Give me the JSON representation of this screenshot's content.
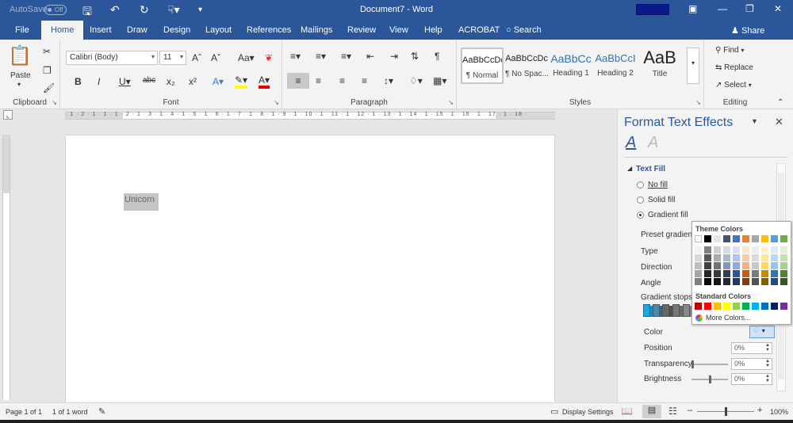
{
  "app": {
    "autosave_label": "AutoSave",
    "autosave_state": "Off",
    "document_title": "Document7  -  Word"
  },
  "tabs": [
    "File",
    "Home",
    "Insert",
    "Draw",
    "Design",
    "Layout",
    "References",
    "Mailings",
    "Review",
    "View",
    "Help",
    "ACROBAT"
  ],
  "active_tab": "Home",
  "search_label": "Search",
  "share_label": "Share",
  "ribbon": {
    "clipboard": {
      "paste": "Paste",
      "label": "Clipboard"
    },
    "font": {
      "name": "Calibri (Body)",
      "size": "11",
      "label": "Font"
    },
    "paragraph": {
      "label": "Paragraph"
    },
    "styles": {
      "label": "Styles",
      "items": [
        {
          "sample": "AaBbCcDc",
          "name": "¶ Normal"
        },
        {
          "sample": "AaBbCcDc",
          "name": "¶ No Spac..."
        },
        {
          "sample": "AaBbCc",
          "name": "Heading 1"
        },
        {
          "sample": "AaBbCcI",
          "name": "Heading 2"
        },
        {
          "sample": "AaB",
          "name": "Title"
        }
      ]
    },
    "editing": {
      "find": "Find",
      "replace": "Replace",
      "select": "Select",
      "label": "Editing"
    }
  },
  "ruler_numbers": "· 1 · 2 · 1 · 1 · 1 · 2 · 1 · 3 · 1 · 4 · 1 · 5 · 1 · 6 · 1 · 7 · 1 · 8 · 1 · 9 · 1 · 10 · 1 · 11 · 1 · 12 · 1 · 13 · 1 · 14 · 1 · 15 · 1 · 16 · 1 · 17 · 1 · 18 ·",
  "document": {
    "selected_text": "Unicorn"
  },
  "pane": {
    "title": "Format Text Effects",
    "section": "Text Fill",
    "fill_options": [
      "No fill",
      "Solid fill",
      "Gradient fill"
    ],
    "selected_fill": "Gradient fill",
    "labels": {
      "preset": "Preset gradients",
      "type": "Type",
      "direction": "Direction",
      "angle": "Angle",
      "stops": "Gradient stops",
      "color": "Color",
      "position": "Position",
      "transparency": "Transparency",
      "brightness": "Brightness"
    },
    "values": {
      "position": "0%",
      "transparency": "0%",
      "brightness": "0%"
    }
  },
  "color_picker": {
    "theme_label": "Theme Colors",
    "standard_label": "Standard Colors",
    "more_label": "More Colors...",
    "theme_top": [
      "#ffffff",
      "#000000",
      "#e7e6e6",
      "#44546a",
      "#4472c4",
      "#ed7d31",
      "#a5a5a5",
      "#ffc000",
      "#5b9bd5",
      "#70ad47"
    ],
    "theme_shades": [
      [
        "#f2f2f2",
        "#808080",
        "#d0cece",
        "#d6dce4",
        "#d9e2f3",
        "#fbe5d5",
        "#ededed",
        "#fff2cc",
        "#deebf6",
        "#e2efd9"
      ],
      [
        "#d8d8d8",
        "#595959",
        "#aeaaaa",
        "#adb9ca",
        "#b4c6e7",
        "#f7caac",
        "#dbdbdb",
        "#fee599",
        "#bdd7ee",
        "#c5e0b3"
      ],
      [
        "#bfbfbf",
        "#404040",
        "#757070",
        "#8496b0",
        "#8eaadb",
        "#f4b183",
        "#c9c9c9",
        "#ffd965",
        "#9cc3e5",
        "#a8d08d"
      ],
      [
        "#a5a5a5",
        "#262626",
        "#3a3838",
        "#323f4f",
        "#2f5496",
        "#c55a11",
        "#7b7b7b",
        "#bf9000",
        "#2e75b5",
        "#538135"
      ],
      [
        "#7f7f7f",
        "#0d0d0d",
        "#171616",
        "#222a35",
        "#1f3864",
        "#833c0b",
        "#525252",
        "#7f6000",
        "#1e4e79",
        "#375623"
      ]
    ],
    "standard": [
      "#c00000",
      "#ff0000",
      "#ffc000",
      "#ffff00",
      "#92d050",
      "#00b050",
      "#00b0f0",
      "#0070c0",
      "#002060",
      "#7030a0"
    ]
  },
  "status": {
    "page": "Page 1 of 1",
    "words": "1 of 1 word",
    "display_settings": "Display Settings",
    "zoom": "100%",
    "zoom_level": 1.0
  },
  "colors": {
    "accent": "#2b579a"
  }
}
